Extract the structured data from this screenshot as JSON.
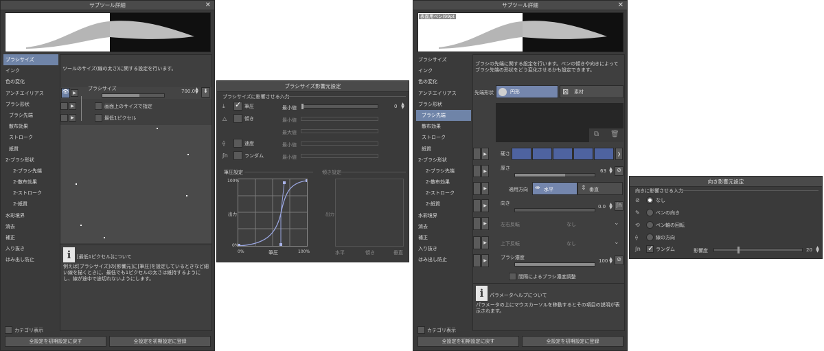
{
  "w1": {
    "title": "サブツール詳細",
    "close": "✕",
    "sidebar": [
      "ブラシサイズ",
      "インク",
      "色の変化",
      "アンチエイリアス",
      "ブラシ形状",
      "ブラシ先端",
      "散布効果",
      "ストローク",
      "紙質",
      "2-ブラシ形状",
      "2-ブラシ先端",
      "2-散布効果",
      "2-ストローク",
      "2-紙質",
      "水彩境界",
      "消去",
      "補正",
      "入り抜き",
      "はみ出し防止"
    ],
    "description": "ツールのサイズ(線の太さ)に関する設定を行います。",
    "brush_size_label": "ブラシサイズ",
    "brush_size_value": "700.0",
    "brush_size_fill": 0.6,
    "screen_size_label": "画面上のサイズで指定",
    "min_pixel_label": "最低1ピクセル",
    "info_title": "[最低1ピクセル]について",
    "info_text": "例えば[ブラシサイズ]の[影響元]に[筆圧]を設定しているときなど細い線を描くときに、最低でも1ピクセルの太さは維持するようにし、線が途中で途切れないようにします。",
    "category_label": "カテゴリ表示",
    "reset_button": "全設定を初期設定に戻す",
    "register_button": "全設定を初期設定に登録"
  },
  "w2": {
    "title": "ブラシサイズ影響元設定",
    "section": "ブラシサイズに影響させる入力",
    "inputs": [
      {
        "label": "筆圧",
        "checked": true,
        "slider_label": "最小値",
        "value": "0",
        "enabled": true
      },
      {
        "label": "傾き",
        "checked": false,
        "slider_label": "最小値",
        "value": "",
        "enabled": false
      },
      {
        "label": "",
        "checked": false,
        "slider_label": "最大値",
        "value": "",
        "enabled": false
      },
      {
        "label": "速度",
        "checked": false,
        "slider_label": "最小値",
        "value": "",
        "enabled": false
      },
      {
        "label": "ランダム",
        "checked": false,
        "slider_label": "最小値",
        "value": "",
        "enabled": false
      }
    ],
    "pressure_title": "筆圧設定",
    "tilt_title": "傾き設定",
    "graph_ymax": "100%",
    "graph_ymid": "出力",
    "graph_ymin": "0%",
    "graph_xmin": "0%",
    "graph_xmid": "筆圧",
    "graph_xmax": "100%",
    "tilt_xlabels": [
      "水平",
      "傾き",
      "垂直"
    ],
    "tilt_ylabel": "出力"
  },
  "w3": {
    "title": "サブツール詳細",
    "close": "✕",
    "preview_label": "表面用ペン(99pt",
    "sidebar": [
      "ブラシサイズ",
      "インク",
      "色の変化",
      "アンチエイリアス",
      "ブラシ形状",
      "ブラシ先端",
      "散布効果",
      "ストローク",
      "紙質",
      "2-ブラシ形状",
      "2-ブラシ先端",
      "2-散布効果",
      "2-ストローク",
      "2-紙質",
      "水彩境界",
      "消去",
      "補正",
      "入り抜き",
      "はみ出し防止"
    ],
    "selected_index": 5,
    "description": "ブラシの先端に関する設定を行います。ペンの傾きや向きによってブラシ先端の形状をどう変化させるかも設定できます。",
    "tip_shape_label": "先端形状",
    "tip_circle": "円形",
    "tip_material": "素材",
    "hardness_label": "硬さ",
    "thickness_label": "厚さ",
    "thickness_value": "63",
    "thickness_fill": 0.63,
    "apply_dir_label": "適用方向",
    "horizontal": "水平",
    "vertical": "垂直",
    "direction_label": "向き",
    "direction_value": "0.0",
    "flip_h_label": "左右反転",
    "flip_h_value": "なし",
    "flip_v_label": "上下反転",
    "flip_v_value": "なし",
    "density_label": "ブラシ濃度",
    "density_value": "100",
    "density_fill": 1.0,
    "spacing_density_label": "間隔によるブラシ濃度調整",
    "info_title": "パラメータヘルプについて",
    "info_text": "パラメータの上にマウスカーソルを移動するとその項目の説明が表示されます。",
    "category_label": "カテゴリ表示",
    "reset_button": "全設定を初期設定に戻す",
    "register_button": "全設定を初期設定に登録"
  },
  "w4": {
    "title": "向き影響元設定",
    "section": "向きに影響させる入力",
    "options": [
      "なし",
      "ペンの向き",
      "ペン軸の回転",
      "線の方向"
    ],
    "random_label": "ランダム",
    "influence_label": "影響度",
    "influence_value": "20",
    "influence_fill": 0.2
  }
}
